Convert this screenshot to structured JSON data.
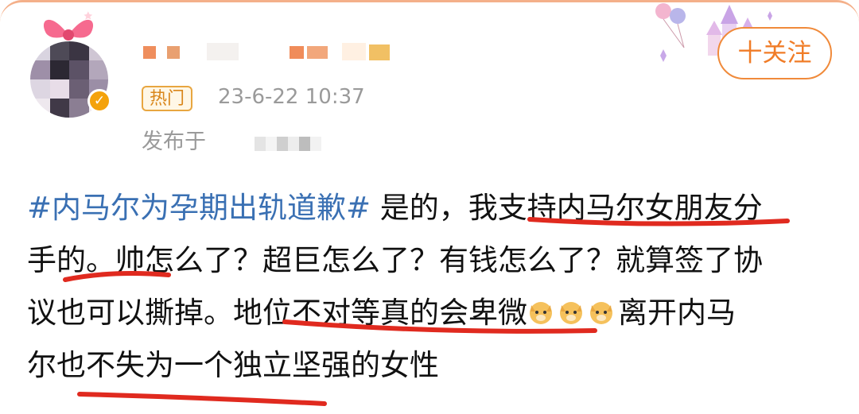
{
  "post": {
    "hot_badge": "热门",
    "timestamp": "23-6-22 10:37",
    "source_prefix": "发布于",
    "follow_label": "十关注",
    "topic": "#内马尔为孕期出轨道歉#",
    "line1_rest": " 是的，我支持内马尔女朋友分",
    "line2": "手的。帅怎么了？超巨怎么了？有钱怎么了？就算签了协",
    "line3_a": "议也可以撕掉。地位不对等真的会卑微",
    "line3_b": "离开内马",
    "line4": "尔也不失为一个独立坚强的女性"
  },
  "icons": {
    "verified": "verified-badge-icon",
    "emoji": "doge-emoji-icon",
    "decor": "balloon-castle-decoration"
  },
  "colors": {
    "topic": "#3a70b3",
    "accent": "#f07c27",
    "underline": "#e02a1f",
    "meta": "#9a9a9a"
  }
}
